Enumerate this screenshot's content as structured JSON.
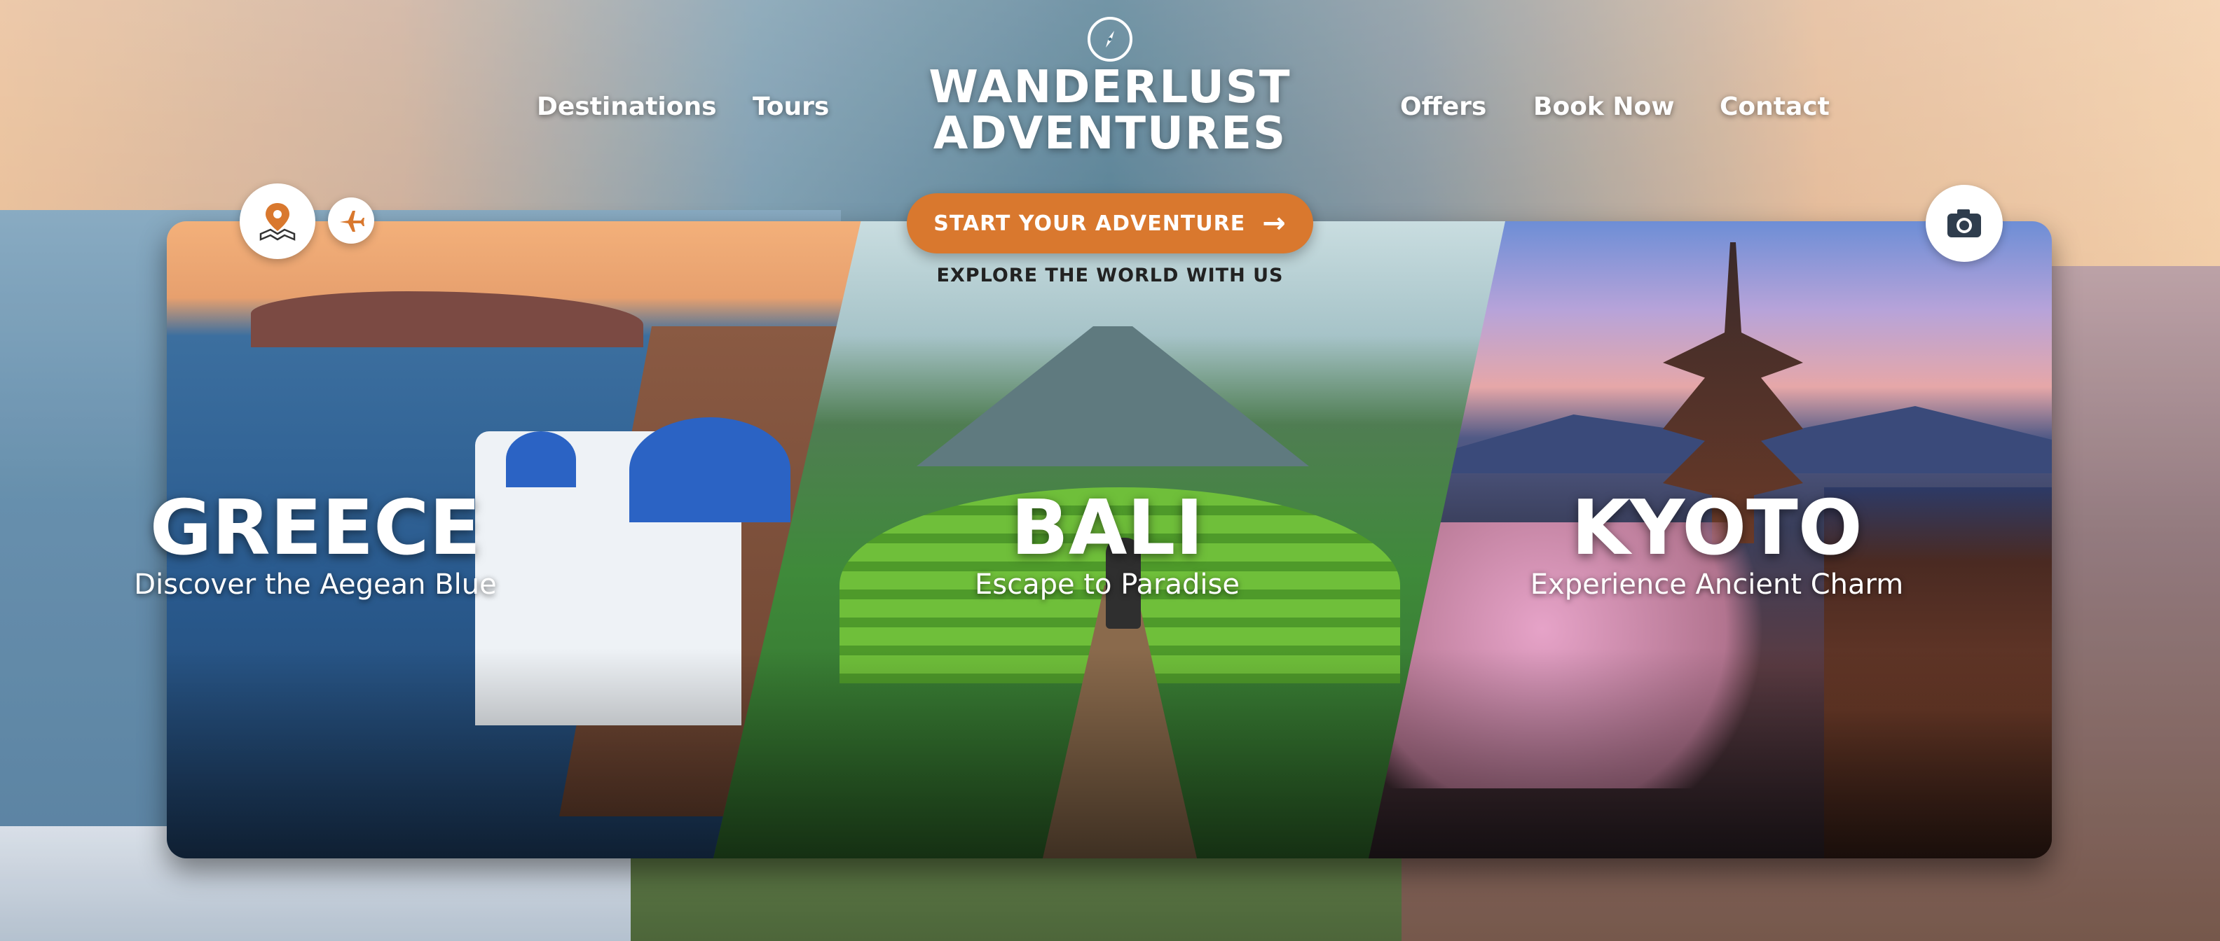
{
  "brand": {
    "line1": "WANDERLUST",
    "line2": "ADVENTURES"
  },
  "nav": {
    "destinations": "Destinations",
    "tours": "Tours",
    "offers": "Offers",
    "book_now": "Book Now",
    "contact": "Contact"
  },
  "hero": {
    "cta_label": "START YOUR ADVENTURE",
    "tagline": "EXPLORE THE WORLD WITH US"
  },
  "destinations": [
    {
      "name": "GREECE",
      "subtitle": "Discover the Aegean Blue"
    },
    {
      "name": "BALI",
      "subtitle": "Escape to Paradise"
    },
    {
      "name": "KYOTO",
      "subtitle": "Experience Ancient Charm"
    }
  ],
  "icons": [
    "compass-icon",
    "map-pin-icon",
    "airplane-icon",
    "camera-icon",
    "arrow-right-icon"
  ],
  "colors": {
    "accent": "#d9782e",
    "text_light": "#ffffff",
    "tagline": "#222222"
  }
}
